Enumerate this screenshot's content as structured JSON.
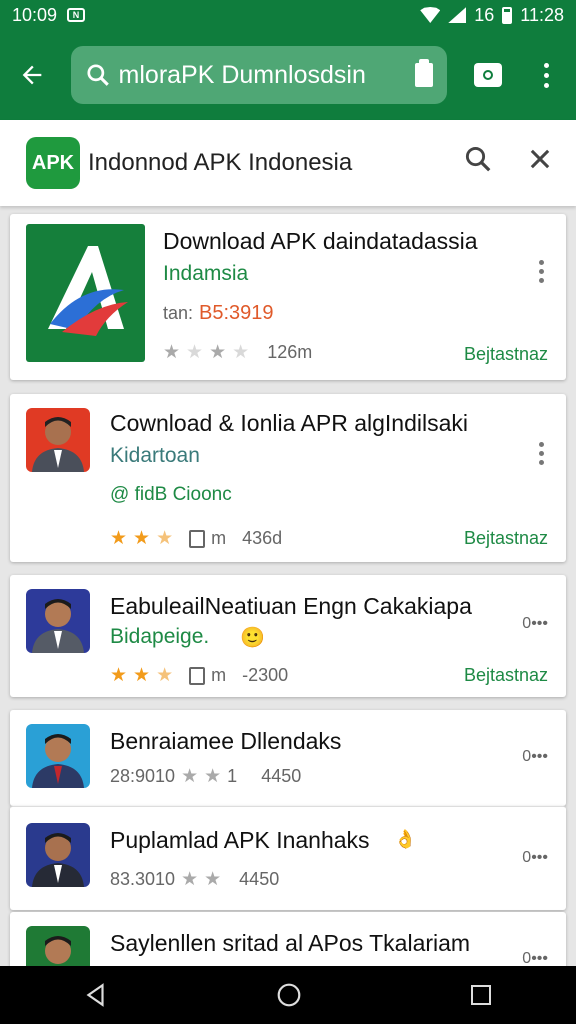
{
  "status_bar": {
    "time_left": "10:09",
    "signal_label": "16",
    "time_right": "11:28"
  },
  "toolbar": {
    "search_text": "mloraPK Dumnlosdsin"
  },
  "header": {
    "logo_text": "APK",
    "title": "Indonnod  APK Indonesia"
  },
  "apps": [
    {
      "name": "Download APK daindatadassia",
      "subtitle": "Indamsia",
      "price_prefix": "tan:",
      "price": "B5:3919",
      "size": "126m",
      "action": "Bejtastnaz"
    },
    {
      "name": "Cownload & Ionlia APR algIndilsaki",
      "subtitle": "Kidartoan",
      "tagline": "@ fidB Cioonc",
      "meta_m": "m",
      "meta_value": "436d",
      "action": "Bejtastnaz"
    },
    {
      "name": "EabuleailNeatiuan Engn Cakakiapa",
      "subtitle": "Bidapeige.",
      "meta_m": "m",
      "meta_value": "-2300",
      "action": "Bejtastnaz",
      "more": "0•••"
    },
    {
      "name": "Benraiamee Dllendaks",
      "meta_left": "28:9010",
      "meta_mid": "1",
      "meta_value": "4450",
      "more": "0•••"
    },
    {
      "name": "Puplamlad APK Inanhaks",
      "meta_left": "83.3010",
      "meta_value": "4450",
      "more": "0•••"
    },
    {
      "name": "Saylenllen sritad al APos Tkalariam",
      "more": "0•••"
    }
  ],
  "colors": {
    "primary": "#0f7d3d",
    "accent_green": "#1e8a45",
    "star": "#f29b1b"
  }
}
